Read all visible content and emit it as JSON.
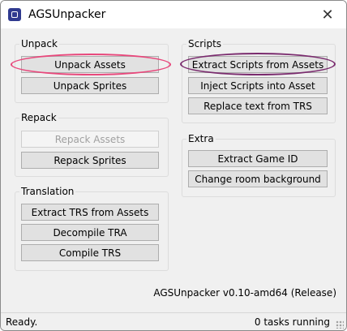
{
  "window": {
    "title": "AGSUnpacker",
    "close_glyph": "✕"
  },
  "groups": {
    "unpack": {
      "label": "Unpack",
      "buttons": [
        "Unpack Assets",
        "Unpack Sprites"
      ]
    },
    "repack": {
      "label": "Repack",
      "buttons": [
        "Repack Assets",
        "Repack Sprites"
      ]
    },
    "translation": {
      "label": "Translation",
      "buttons": [
        "Extract TRS from Assets",
        "Decompile TRA",
        "Compile TRS"
      ]
    },
    "scripts": {
      "label": "Scripts",
      "buttons": [
        "Extract Scripts from Assets",
        "Inject Scripts into Asset",
        "Replace text from TRS"
      ]
    },
    "extra": {
      "label": "Extra",
      "buttons": [
        "Extract Game ID",
        "Change room background"
      ]
    }
  },
  "version": "AGSUnpacker v0.10-amd64 (Release)",
  "status": {
    "left": "Ready.",
    "right": "0 tasks running"
  },
  "highlights": {
    "pink": "#e8487c",
    "purple": "#7a2b6e"
  }
}
